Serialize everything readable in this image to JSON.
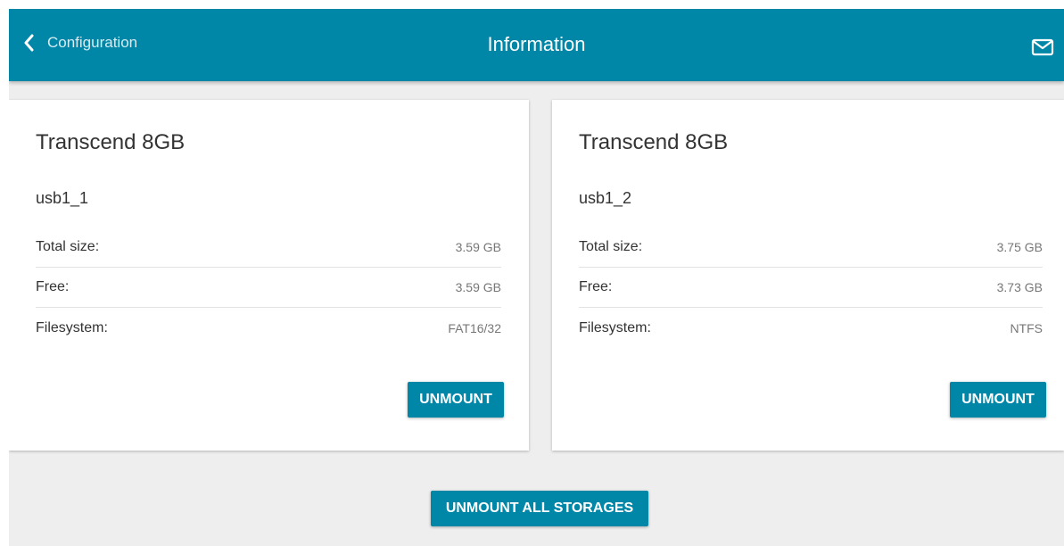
{
  "header": {
    "back_label": "Configuration",
    "title": "Information",
    "back_icon": "chevron-left-icon",
    "mail_icon": "mail-icon"
  },
  "storages": [
    {
      "title": "Transcend 8GB",
      "name": "usb1_1",
      "rows": [
        {
          "label": "Total size:",
          "value": "3.59 GB"
        },
        {
          "label": "Free:",
          "value": "3.59 GB"
        },
        {
          "label": "Filesystem:",
          "value": "FAT16/32"
        }
      ],
      "unmount_label": "UNMOUNT"
    },
    {
      "title": "Transcend 8GB",
      "name": "usb1_2",
      "rows": [
        {
          "label": "Total size:",
          "value": "3.75 GB"
        },
        {
          "label": "Free:",
          "value": "3.73 GB"
        },
        {
          "label": "Filesystem:",
          "value": "NTFS"
        }
      ],
      "unmount_label": "UNMOUNT"
    }
  ],
  "unmount_all_label": "UNMOUNT ALL STORAGES",
  "colors": {
    "accent": "#0087a8",
    "background": "#eeeeee",
    "card": "#ffffff"
  }
}
